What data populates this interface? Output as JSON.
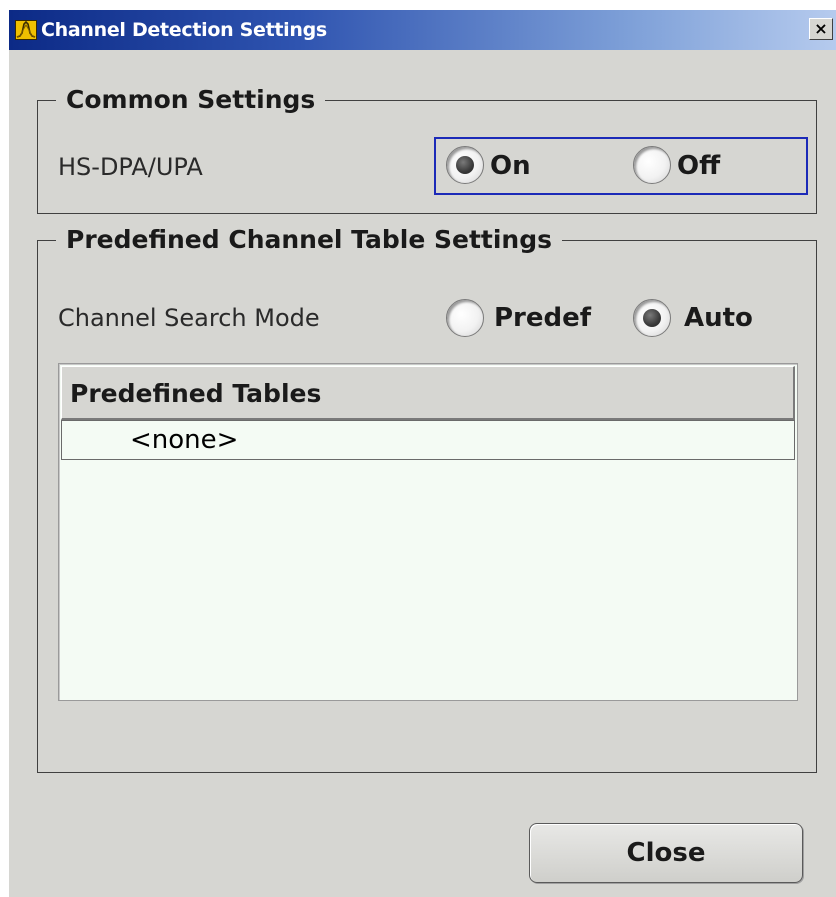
{
  "window": {
    "title": "Channel Detection Settings",
    "close_glyph": "×"
  },
  "common_settings": {
    "legend": "Common Settings",
    "hsdpa_label": "HS-DPA/UPA",
    "options": [
      {
        "label": "On",
        "selected": true
      },
      {
        "label": "Off",
        "selected": false
      }
    ]
  },
  "predefined": {
    "legend": "Predefined Channel Table Settings",
    "search_mode_label": "Channel Search Mode",
    "options": [
      {
        "label": "Predef",
        "selected": false
      },
      {
        "label": "Auto",
        "selected": true
      }
    ],
    "table": {
      "header": "Predefined Tables",
      "rows": [
        "<none>"
      ]
    }
  },
  "buttons": {
    "close_label": "Close"
  },
  "colors": {
    "title_gradient_start": "#0c2a86",
    "title_gradient_end": "#b6cbee",
    "dialog_bg": "#d6d6d2",
    "focus_border": "#1c2ab8",
    "table_bg": "#f4fbf4"
  },
  "icons": {
    "app": "spectrum-app-icon",
    "close": "close-icon"
  }
}
